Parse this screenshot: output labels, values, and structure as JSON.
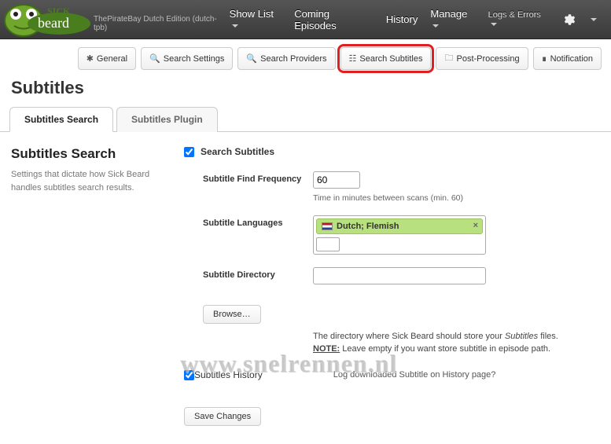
{
  "header": {
    "edition": "ThePirateBay Dutch Edition (dutch-tpb)",
    "nav": {
      "show_list": "Show List",
      "coming": "Coming Episodes",
      "history": "History",
      "manage": "Manage",
      "logs": "Logs & Errors"
    }
  },
  "tabButtons": {
    "general": "General",
    "search_settings": "Search Settings",
    "search_providers": "Search Providers",
    "search_subtitles": "Search Subtitles",
    "post_processing": "Post-Processing",
    "notification": "Notification"
  },
  "page": {
    "title": "Subtitles",
    "subtabs": {
      "search": "Subtitles Search",
      "plugin": "Subtitles Plugin"
    }
  },
  "side": {
    "heading": "Subtitles Search",
    "desc": "Settings that dictate how Sick Beard handles subtitles search results."
  },
  "form": {
    "search_subtitles_label": "Search Subtitles",
    "freq_label": "Subtitle Find Frequency",
    "freq_value": "60",
    "freq_help": "Time in minutes between scans (min. 60)",
    "lang_label": "Subtitle Languages",
    "lang_selected": "Dutch; Flemish",
    "dir_label": "Subtitle Directory",
    "browse": "Browse…",
    "dir_help1_a": "The directory where Sick Beard should store your ",
    "dir_help1_b": "Subtitles",
    "dir_help1_c": " files.",
    "dir_help2_a": "NOTE:",
    "dir_help2_b": " Leave empty if you want store subtitle in episode path.",
    "history_label": "Subtitles History",
    "history_desc": "Log downloaded Subtitle on History page?",
    "save": "Save Changes"
  },
  "watermark": "www.snelrennen.nl"
}
